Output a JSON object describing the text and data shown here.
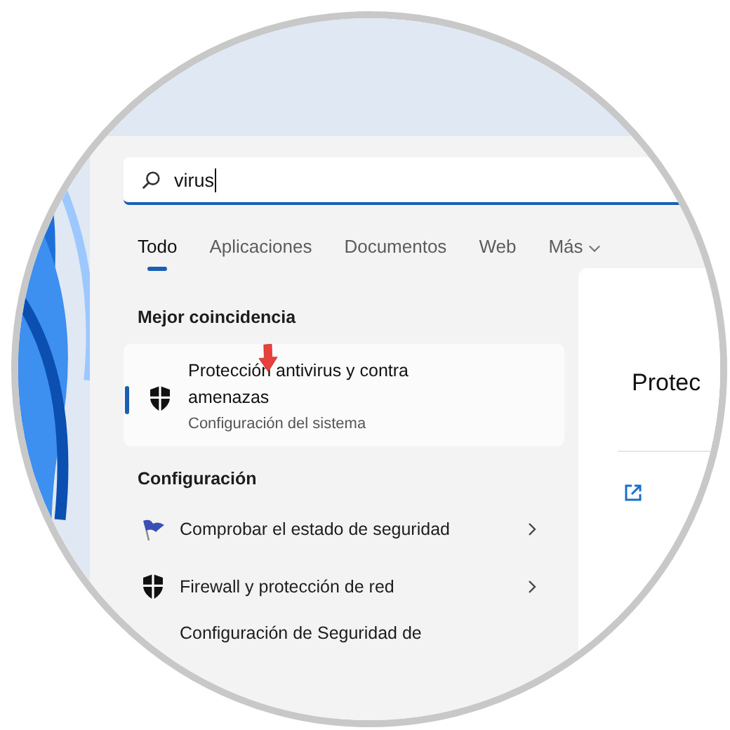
{
  "search": {
    "value": "virus"
  },
  "tabs": [
    {
      "label": "Todo",
      "selected": true,
      "kind": "tab"
    },
    {
      "label": "Aplicaciones",
      "selected": false,
      "kind": "tab"
    },
    {
      "label": "Documentos",
      "selected": false,
      "kind": "tab"
    },
    {
      "label": "Web",
      "selected": false,
      "kind": "tab"
    },
    {
      "label": "Más",
      "selected": false,
      "kind": "dropdown"
    }
  ],
  "best_match": {
    "heading": "Mejor coincidencia",
    "item": {
      "title": "Protección antivirus y contra amenazas",
      "subtitle": "Configuración del sistema",
      "selected": true
    }
  },
  "settings": {
    "heading": "Configuración",
    "items": [
      {
        "label": "Comprobar el estado de seguridad",
        "kind": "flag"
      },
      {
        "label": "Firewall y protección de red",
        "kind": "shield"
      },
      {
        "label": "Configuración de Seguridad de",
        "kind": "cut"
      }
    ]
  },
  "detail": {
    "title": "Protec"
  }
}
